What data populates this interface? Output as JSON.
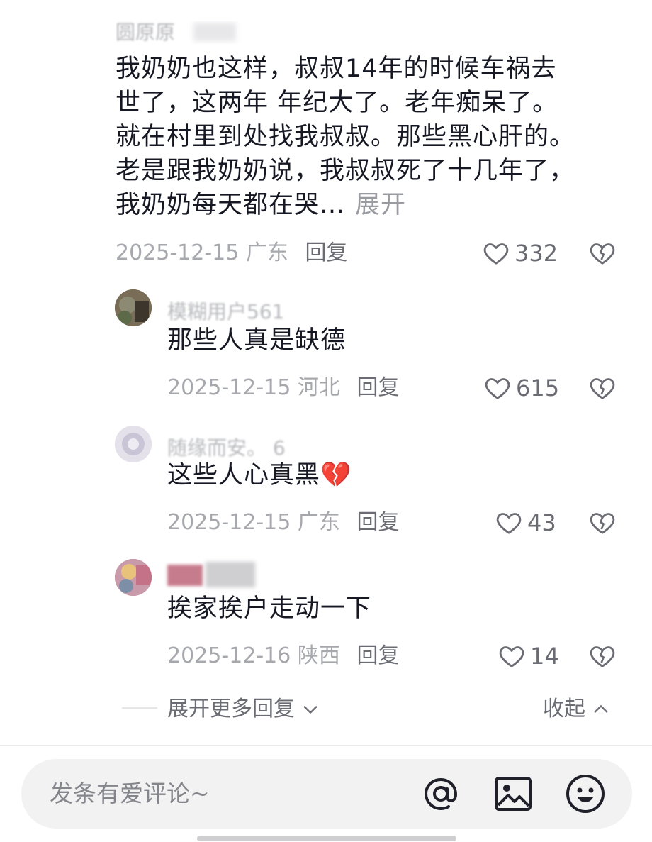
{
  "main_comment": {
    "username": "圆原原",
    "lines": [
      "我奶奶也这样，叔叔14年的时候车祸去",
      "世了，这两年 年纪大了。老年痴呆了。",
      "就在村里到处找我叔叔。那些黑心肝的。",
      "老是跟我奶奶说，我叔叔死了十几年了，",
      "我奶奶每天都在哭…"
    ],
    "expand_label": "展开",
    "date": "2025-12-15",
    "location": "广东",
    "reply_label": "回复",
    "likes": "332"
  },
  "replies": [
    {
      "username": "模糊用户561",
      "text": "那些人真是缺德",
      "date": "2025-12-15",
      "location": "河北",
      "reply_label": "回复",
      "likes": "615",
      "avatar_color": "#6a6148"
    },
    {
      "username": "随缘而安。 6",
      "text": "这些人心真黑",
      "emoji": "💔",
      "date": "2025-12-15",
      "location": "广东",
      "reply_label": "回复",
      "likes": "43",
      "avatar_color": "#d9d6e3"
    },
    {
      "username": "",
      "text": "挨家挨户走动一下",
      "date": "2025-12-16",
      "location": "陕西",
      "reply_label": "回复",
      "likes": "14",
      "avatar_color": "#b7859a"
    }
  ],
  "footer": {
    "more_replies_label": "展开更多回复",
    "collapse_label": "收起"
  },
  "input": {
    "placeholder": "发条有爱评论~"
  },
  "icons": {
    "like": "heart-outline-icon",
    "dislike": "broken-heart-icon",
    "mention": "at-sign-icon",
    "image": "image-icon",
    "emoji": "smiley-icon"
  },
  "colors": {
    "text_primary": "#161823",
    "text_secondary": "#a7a8ad",
    "action_text": "#6b6c73",
    "broken_heart_emoji": "#e0325a"
  }
}
